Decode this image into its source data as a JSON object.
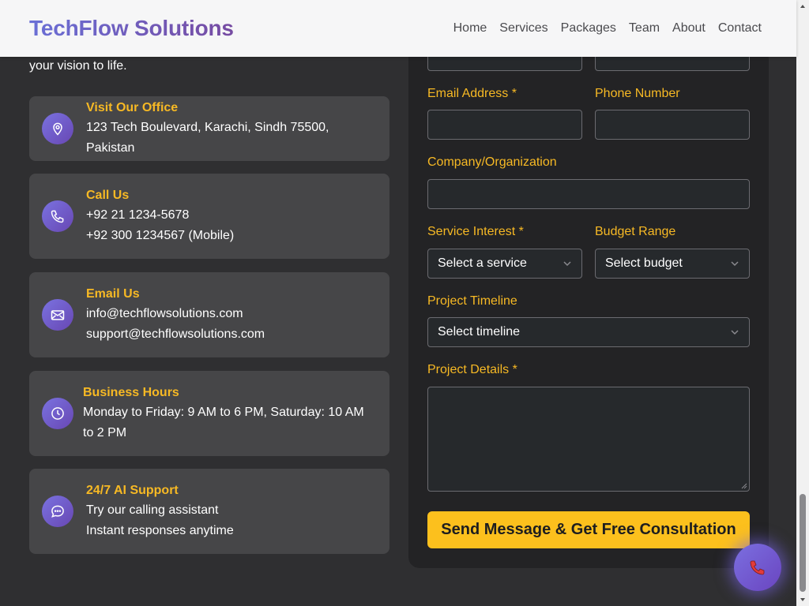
{
  "header": {
    "brand": "TechFlow Solutions",
    "nav": [
      "Home",
      "Services",
      "Packages",
      "Team",
      "About",
      "Contact"
    ]
  },
  "intro_tail": "your vision to life.",
  "contact_cards": [
    {
      "icon": "location-pin-icon",
      "title": "Visit Our Office",
      "lines": [
        "123 Tech Boulevard, Karachi, Sindh 75500, Pakistan"
      ]
    },
    {
      "icon": "phone-icon",
      "title": "Call Us",
      "lines": [
        "+92 21 1234-5678",
        "+92 300 1234567 (Mobile)"
      ]
    },
    {
      "icon": "envelope-icon",
      "title": "Email Us",
      "lines": [
        "info@techflowsolutions.com",
        "support@techflowsolutions.com"
      ]
    },
    {
      "icon": "clock-icon",
      "title": "Business Hours",
      "lines": [
        "Monday to Friday: 9 AM to 6 PM, Saturday: 10 AM",
        "to 2 PM"
      ]
    },
    {
      "icon": "chat-bubble-icon",
      "title": "24/7 AI Support",
      "lines": [
        "Try our calling assistant",
        "Instant responses anytime"
      ]
    }
  ],
  "form": {
    "email_label": "Email Address *",
    "phone_label": "Phone Number",
    "company_label": "Company/Organization",
    "service_label": "Service Interest *",
    "service_value": "Select a service",
    "budget_label": "Budget Range",
    "budget_value": "Select budget",
    "timeline_label": "Project Timeline",
    "timeline_value": "Select timeline",
    "details_label": "Project Details *",
    "submit_label": "Send Message & Get Free Consultation"
  },
  "colors": {
    "accent": "#f7b924",
    "brand_gradient": [
      "#6a6fd6",
      "#764ba2"
    ],
    "background": "#2f2f31",
    "card": "#464648",
    "panel": "#232325",
    "button": "#fcc01d"
  }
}
